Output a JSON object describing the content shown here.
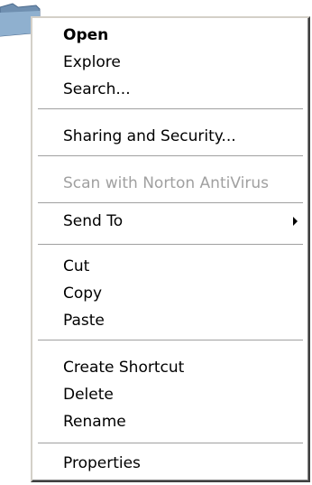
{
  "menu": {
    "open": "Open",
    "explore": "Explore",
    "search": "Search...",
    "sharing_security": "Sharing and Security...",
    "scan_norton": "Scan with Norton AntiVirus",
    "send_to": "Send To",
    "cut": "Cut",
    "copy": "Copy",
    "paste": "Paste",
    "create_shortcut": "Create Shortcut",
    "delete": "Delete",
    "rename": "Rename",
    "properties": "Properties"
  },
  "icons": {
    "folder": "folder-icon",
    "submenu_arrow": "chevron-right-icon"
  },
  "colors": {
    "menu_background": "#ffffff",
    "disabled_text": "#a0a0a0",
    "folder_blue": "#6f8fb0"
  }
}
